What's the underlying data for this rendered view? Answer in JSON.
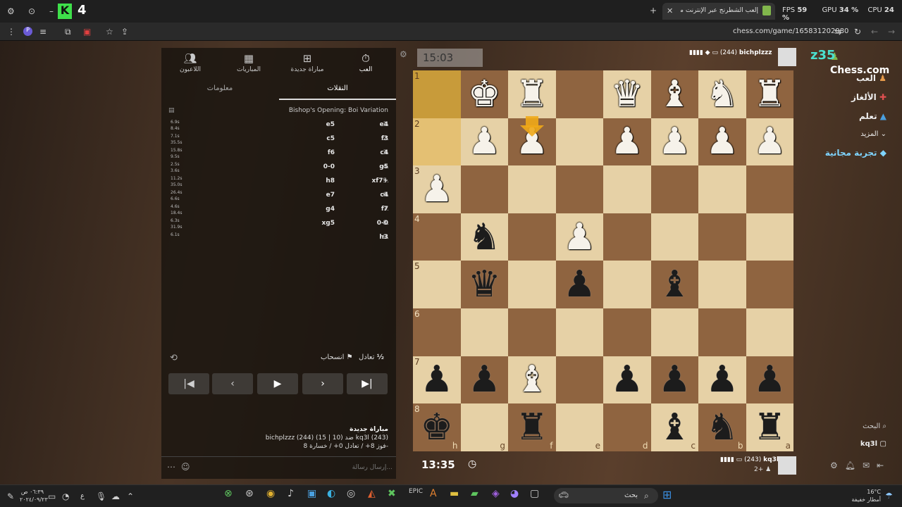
{
  "os": {
    "topbar_left_badge": "4",
    "tab_title": "إلعب الشطرنج عبر الإنترنت مجانًا",
    "tab_new": "+",
    "perf": {
      "fps_label": "FPS",
      "fps": "59",
      "gpu_label": "GPU",
      "gpu": "34 %",
      "cpu_label": "CPU",
      "cpu": "24 %"
    },
    "url": "chess.com/game/165831202980"
  },
  "site": {
    "logo_text": "Chess.com",
    "nav": [
      "العب",
      "الألغاز",
      "تعلم",
      "المزيد",
      "تجربة مجانية"
    ],
    "search_label": "البحث",
    "user_label": "kq3l"
  },
  "top_player": {
    "name": "bichplzzz",
    "rating": "(244)",
    "clock": "15:03",
    "overlay": "z35"
  },
  "bottom_player": {
    "name": "kq3l",
    "rating": "(243)",
    "clock": "13:35",
    "captured": "2+"
  },
  "panel": {
    "nav": [
      {
        "label": "العب",
        "icon": "stopwatch-icon"
      },
      {
        "label": "مباراة جديدة",
        "icon": "plus-icon"
      },
      {
        "label": "المباريات",
        "icon": "board-icon"
      },
      {
        "label": "اللاعبون",
        "icon": "players-icon"
      }
    ],
    "tabs": [
      "النقلات",
      "معلومات"
    ],
    "opening": "Bishop's Opening: Boi Variation",
    "moves": [
      {
        "n": "1.",
        "w": "e4",
        "b": "e5",
        "tw": "6.9s",
        "tb": "8.4s"
      },
      {
        "n": "2.",
        "w": "f3",
        "b": "c5",
        "tw": "7.1s",
        "tb": "35.5s"
      },
      {
        "n": "3.",
        "w": "c4",
        "b": "f6",
        "tw": "15.8s",
        "tb": "9.5s"
      },
      {
        "n": "4.",
        "w": "g5",
        "b": "0-0",
        "tw": "2.5s",
        "tb": "3.6s"
      },
      {
        "n": "5.",
        "w": "xf7+",
        "b": "h8",
        "tw": "11.2s",
        "tb": "35.0s"
      },
      {
        "n": "6.",
        "w": "c4",
        "b": "e7",
        "tw": "26.4s",
        "tb": "6.6s"
      },
      {
        "n": "7.",
        "w": "f7",
        "b": "g4",
        "tw": "4.6s",
        "tb": "18.4s"
      },
      {
        "n": "8.",
        "w": "0-0",
        "b": "xg5",
        "tw": "6.3s",
        "tb": "31.9s"
      },
      {
        "n": "9.",
        "w": "h3",
        "b": "",
        "tw": "6.1s",
        "tb": ""
      }
    ],
    "draw_label": "تعادل",
    "draw_icon": "½",
    "resign_label": "انسحاب",
    "game_info_title": "مباراة جديدة",
    "game_info_line1": "bichplzzz (244) ضد (10 | 15) kq3l (243)",
    "game_info_line2": "فوز 8+ / تعادل 0+ / خسارة 8-",
    "chat_placeholder": "إرسال رسالة..."
  },
  "board": {
    "ranks": [
      "1",
      "2",
      "3",
      "4",
      "5",
      "6",
      "7",
      "8"
    ],
    "files": [
      "h",
      "g",
      "f",
      "e",
      "d",
      "c",
      "b",
      "a"
    ],
    "rows": [
      [
        "",
        "K",
        "R",
        "",
        "Q",
        "B",
        "N",
        "R"
      ],
      [
        "",
        "P",
        "P",
        "",
        "P",
        "P",
        "P",
        "P"
      ],
      [
        "P",
        "",
        "",
        "",
        "",
        "",
        "",
        ""
      ],
      [
        "",
        "n",
        "",
        "P",
        "",
        "",
        "",
        ""
      ],
      [
        "",
        "q",
        "",
        "p",
        "",
        "b",
        "",
        ""
      ],
      [
        "",
        "",
        "",
        "",
        "",
        "",
        "",
        ""
      ],
      [
        "p",
        "p",
        "B",
        "",
        "p",
        "p",
        "p",
        "p"
      ],
      [
        "k",
        "",
        "r",
        "",
        "",
        "b",
        "n",
        "r"
      ]
    ]
  },
  "taskbar": {
    "weather_temp": "16°C",
    "weather_text": "أمطار خفيفة",
    "search_placeholder": "بحث",
    "time": "٠٦:٣٩ ص",
    "date": "٢٠٢٤/٠٩/٢٣",
    "lang": "ع"
  },
  "colors": {
    "light_square": "#e6d1a6",
    "dark_square": "#8f6440",
    "highlight": "#c89b3a",
    "accent": "#81b64c"
  }
}
